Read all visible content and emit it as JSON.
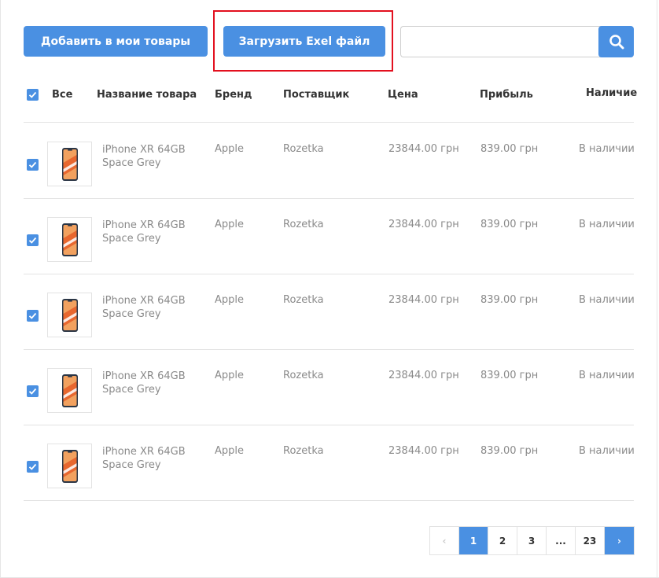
{
  "toolbar": {
    "add_label": "Добавить в мои товары",
    "upload_label": "Загрузить Exel файл",
    "search_placeholder": "",
    "search_value": ""
  },
  "table": {
    "headers": {
      "all": "Все",
      "name": "Название товара",
      "brand": "Бренд",
      "supplier": "Поставщик",
      "price": "Цена",
      "profit": "Прибыль",
      "availability": "Наличие"
    },
    "rows": [
      {
        "name_line1": "iPhone XR 64GB",
        "name_line2": "Space Grey",
        "brand": "Apple",
        "supplier": "Rozetka",
        "price": "23844.00 грн",
        "profit": "839.00 грн",
        "availability": "В наличии",
        "checked": true
      },
      {
        "name_line1": "iPhone XR 64GB",
        "name_line2": "Space Grey",
        "brand": "Apple",
        "supplier": "Rozetka",
        "price": "23844.00 грн",
        "profit": "839.00 грн",
        "availability": "В наличии",
        "checked": true
      },
      {
        "name_line1": "iPhone XR 64GB",
        "name_line2": "Space Grey",
        "brand": "Apple",
        "supplier": "Rozetka",
        "price": "23844.00 грн",
        "profit": "839.00 грн",
        "availability": "В наличии",
        "checked": true
      },
      {
        "name_line1": "iPhone XR 64GB",
        "name_line2": "Space Grey",
        "brand": "Apple",
        "supplier": "Rozetka",
        "price": "23844.00 грн",
        "profit": "839.00 грн",
        "availability": "В наличии",
        "checked": true
      },
      {
        "name_line1": "iPhone XR 64GB",
        "name_line2": "Space Grey",
        "brand": "Apple",
        "supplier": "Rozetka",
        "price": "23844.00 грн",
        "profit": "839.00 грн",
        "availability": "В наличии",
        "checked": true
      }
    ]
  },
  "pagination": {
    "prev": "‹",
    "pages": [
      "1",
      "2",
      "3",
      "...",
      "23"
    ],
    "active": "1",
    "next": "›"
  },
  "colors": {
    "accent": "#4a90e2",
    "highlight": "#e3101f",
    "muted_text": "#8a8a8a"
  },
  "icons": {
    "search": "search-icon",
    "check": "checkmark-icon",
    "product": "phone-thumbnail"
  }
}
